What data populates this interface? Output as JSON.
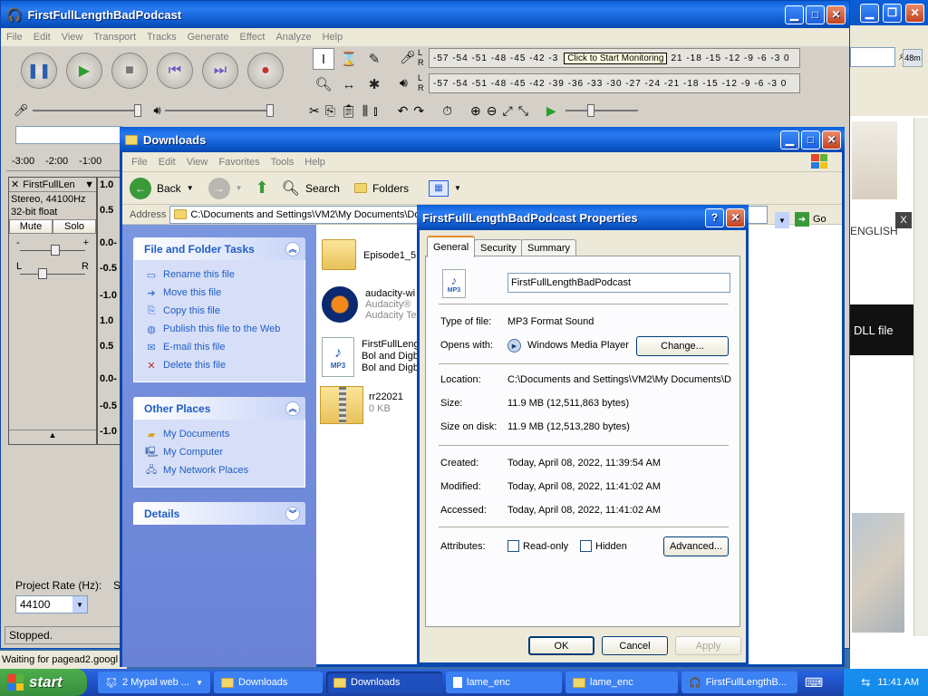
{
  "audacity": {
    "title": "FirstFullLengthBadPodcast",
    "menu": [
      "File",
      "Edit",
      "View",
      "Transport",
      "Tracks",
      "Generate",
      "Effect",
      "Analyze",
      "Help"
    ],
    "meter_ticks": "-57 -54 -51 -48 -45 -42 -3",
    "meter_ticks_right": "21 -18 -15 -12 -9 -6 -3 0",
    "meter_ticks_full": "-57 -54 -51 -48 -45 -42 -39 -36 -33 -30 -27 -24 -21 -18 -15 -12 -9 -6 -3 0",
    "monitor_tooltip": "Click to Start Monitoring",
    "meter_L": "L",
    "meter_R": "R",
    "timeline": [
      "-3:00",
      "-2:00",
      "-1:00"
    ],
    "track_name": "FirstFullLen",
    "track_info1": "Stereo, 44100Hz",
    "track_info2": "32-bit float",
    "mute": "Mute",
    "solo": "Solo",
    "pan_L": "L",
    "pan_R": "R",
    "gain_minus": "-",
    "gain_plus": "+",
    "scale": [
      "1.0",
      "0.5",
      "0.0-",
      "-0.5",
      "-1.0",
      "1.0",
      "0.5",
      "0.0-",
      "-0.5",
      "-1.0"
    ],
    "project_rate_label": "Project Rate (Hz):",
    "project_rate_value": "44100",
    "snap_label": "S",
    "status": "Stopped."
  },
  "background_browser": {
    "zoom_badge": "48m",
    "language": "ENGLISH",
    "dll_button": "DLL file",
    "ad_mark": "X",
    "status": "Waiting for pagead2.googl"
  },
  "explorer": {
    "title": "Downloads",
    "menu": [
      "File",
      "Edit",
      "View",
      "Favorites",
      "Tools",
      "Help"
    ],
    "back": "Back",
    "search": "Search",
    "folders": "Folders",
    "address_label": "Address",
    "address_value": "C:\\Documents and Settings\\VM2\\My Documents\\Dow",
    "go": "Go",
    "tasks_title": "File and Folder Tasks",
    "tasks": [
      "Rename this file",
      "Move this file",
      "Copy this file",
      "Publish this file to the Web",
      "E-mail this file",
      "Delete this file"
    ],
    "places_title": "Other Places",
    "places": [
      "My Documents",
      "My Computer",
      "My Network Places"
    ],
    "details_title": "Details",
    "files": [
      {
        "name": "Episode1_5",
        "line2": "",
        "line3": ""
      },
      {
        "name": "audacity-wi",
        "line2": "Audacity®",
        "line3": "Audacity Te"
      },
      {
        "name": "FirstFullLeng",
        "line2": "Bol and Digb",
        "line3": "Bol and Digb"
      },
      {
        "name": "rr22021",
        "line2": "0 KB",
        "line3": ""
      }
    ]
  },
  "dialog": {
    "title": "FirstFullLengthBadPodcast Properties",
    "tabs": [
      "General",
      "Security",
      "Summary"
    ],
    "filename": "FirstFullLengthBadPodcast",
    "mp3_label": "MP3",
    "type_label": "Type of file:",
    "type_value": "MP3 Format Sound",
    "opens_label": "Opens with:",
    "opens_value": "Windows Media Player",
    "change_btn": "Change...",
    "location_label": "Location:",
    "location_value": "C:\\Documents and Settings\\VM2\\My Documents\\D",
    "size_label": "Size:",
    "size_value": "11.9 MB (12,511,863 bytes)",
    "disk_label": "Size on disk:",
    "disk_value": "11.9 MB (12,513,280 bytes)",
    "created_label": "Created:",
    "created_value": "Today, April 08, 2022, 11:39:54 AM",
    "modified_label": "Modified:",
    "modified_value": "Today, April 08, 2022, 11:41:02 AM",
    "accessed_label": "Accessed:",
    "accessed_value": "Today, April 08, 2022, 11:41:02 AM",
    "attributes_label": "Attributes:",
    "readonly_label": "Read-only",
    "hidden_label": "Hidden",
    "advanced_btn": "Advanced...",
    "ok": "OK",
    "cancel": "Cancel",
    "apply": "Apply"
  },
  "taskbar": {
    "start": "start",
    "items": [
      "2 Mypal web ...",
      "Downloads",
      "Downloads",
      "lame_enc",
      "lame_enc",
      "FirstFullLengthB..."
    ],
    "clock": "11:41 AM"
  },
  "colors": {
    "xp_blue": "#0a48b0",
    "task_link": "#215dc6",
    "start_green": "#388e3c"
  }
}
